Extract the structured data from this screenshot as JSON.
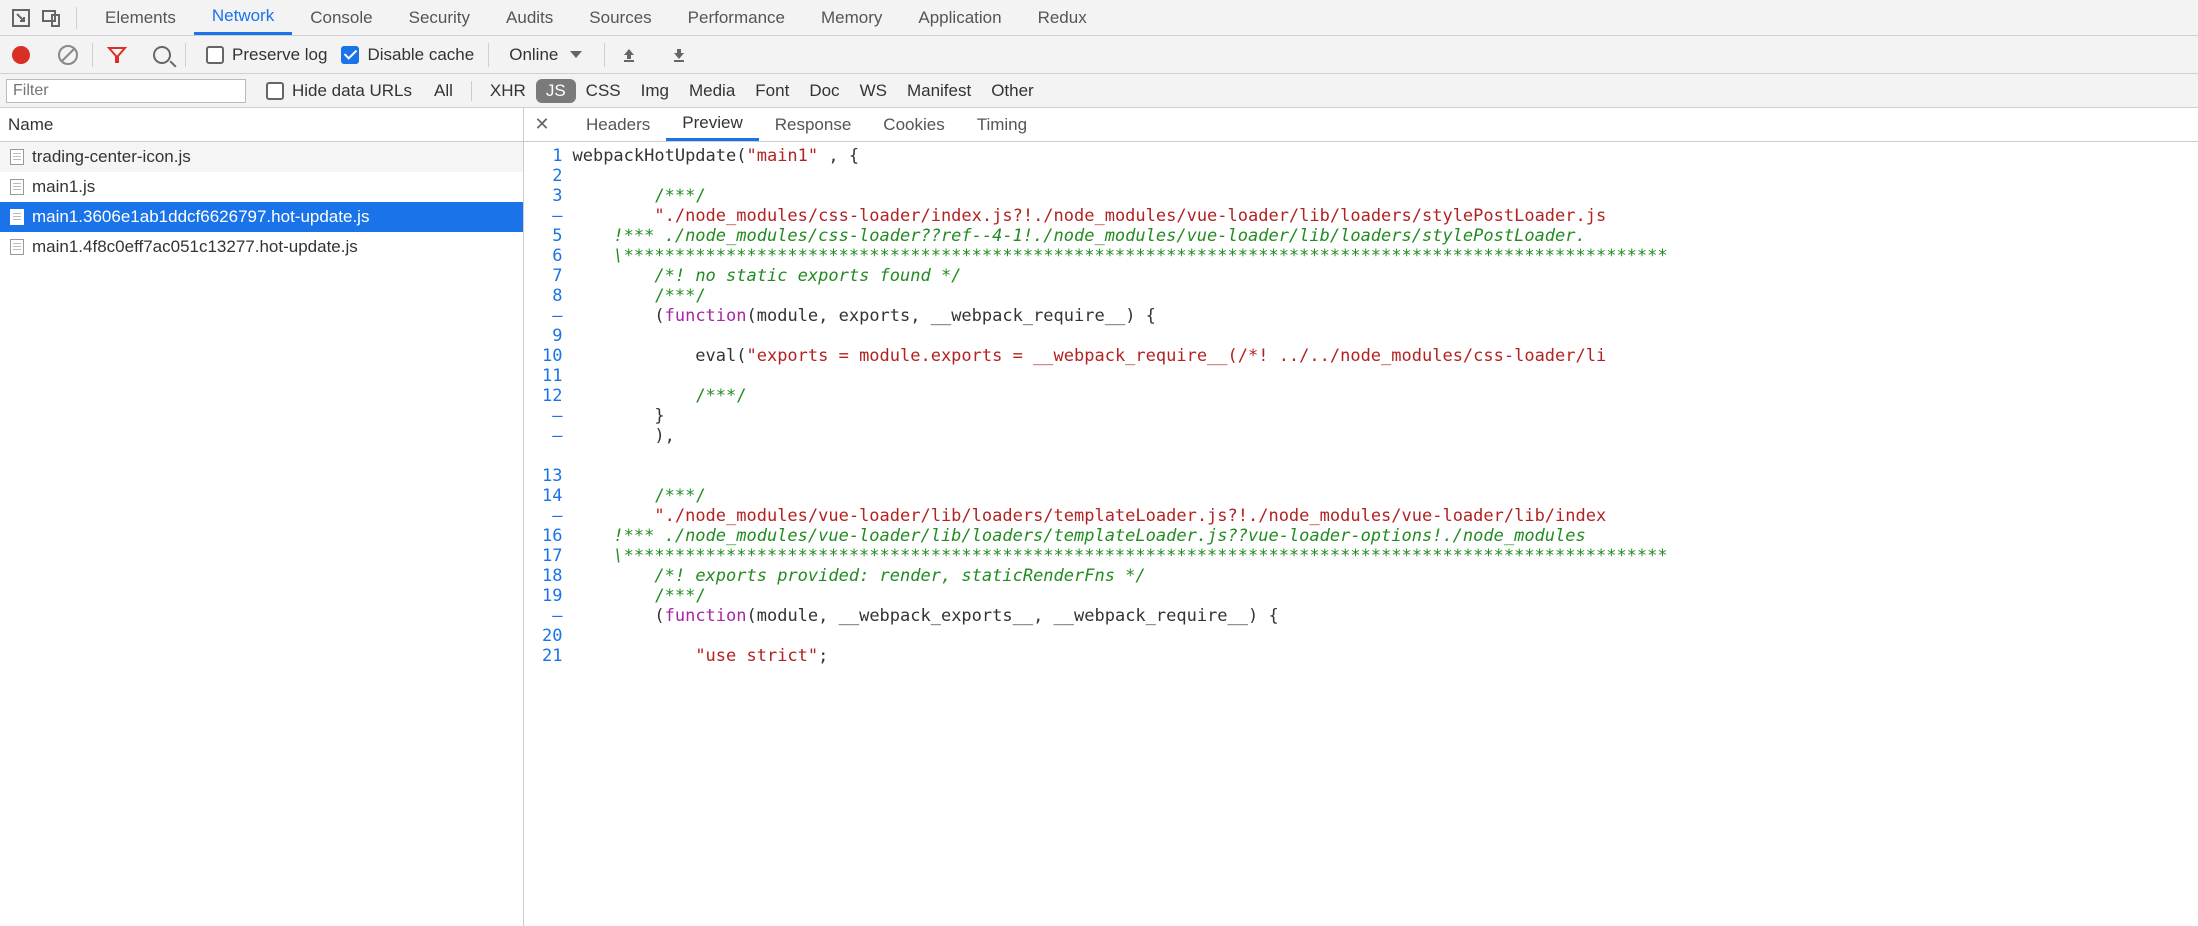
{
  "top_tabs": {
    "items": [
      "Elements",
      "Network",
      "Console",
      "Security",
      "Audits",
      "Sources",
      "Performance",
      "Memory",
      "Application",
      "Redux"
    ],
    "active": "Network"
  },
  "net_toolbar": {
    "preserve_log_label": "Preserve log",
    "preserve_log_checked": false,
    "disable_cache_label": "Disable cache",
    "disable_cache_checked": true,
    "online_label": "Online"
  },
  "filter_bar": {
    "placeholder": "Filter",
    "value": "",
    "hide_data_urls_label": "Hide data URLs",
    "hide_data_urls_checked": false,
    "type_all": "All",
    "types": [
      "XHR",
      "JS",
      "CSS",
      "Img",
      "Media",
      "Font",
      "Doc",
      "WS",
      "Manifest",
      "Other"
    ],
    "type_selected": "JS"
  },
  "req_list": {
    "header": "Name",
    "items": [
      "trading-center-icon.js",
      "main1.js",
      "main1.3606e1ab1ddcf6626797.hot-update.js",
      "main1.4f8c0eff7ac051c13277.hot-update.js"
    ],
    "selected_index": 2
  },
  "detail_tabs": {
    "items": [
      "Headers",
      "Preview",
      "Response",
      "Cookies",
      "Timing"
    ],
    "active": "Preview"
  },
  "code": {
    "gutter": [
      "1",
      "2",
      "3",
      "–",
      "5",
      "6",
      "7",
      "8",
      "–",
      "9",
      "10",
      "11",
      "12",
      "–",
      "–",
      "",
      "13",
      "14",
      "–",
      "16",
      "17",
      "18",
      "19",
      "–",
      "20",
      "21"
    ],
    "lines": [
      [
        [
          "",
          "webpackHotUpdate("
        ],
        [
          "s",
          "\"main1\""
        ],
        [
          "",
          " , {"
        ]
      ],
      [
        [
          "",
          ""
        ]
      ],
      [
        [
          "",
          "        "
        ],
        [
          "c2",
          "/***/"
        ]
      ],
      [
        [
          "",
          "        "
        ],
        [
          "s",
          "\"./node_modules/css-loader/index.js?!./node_modules/vue-loader/lib/loaders/stylePostLoader.js"
        ]
      ],
      [
        [
          "c",
          "    !*** ./node_modules/css-loader??ref--4-1!./node_modules/vue-loader/lib/loaders/stylePostLoader."
        ]
      ],
      [
        [
          "c",
          "    \\******************************************************************************************************"
        ]
      ],
      [
        [
          "",
          "        "
        ],
        [
          "c",
          "/*! no static exports found */"
        ]
      ],
      [
        [
          "",
          "        "
        ],
        [
          "c2",
          "/***/"
        ]
      ],
      [
        [
          "",
          "        ("
        ],
        [
          "k",
          "function"
        ],
        [
          "",
          "(module, exports, __webpack_require__) {"
        ]
      ],
      [
        [
          "",
          ""
        ]
      ],
      [
        [
          "",
          "            eval("
        ],
        [
          "s",
          "\"exports = module.exports = __webpack_require__(/*! ../../node_modules/css-loader/li"
        ]
      ],
      [
        [
          "",
          ""
        ]
      ],
      [
        [
          "",
          "            "
        ],
        [
          "c2",
          "/***/"
        ]
      ],
      [
        [
          "",
          "        }"
        ]
      ],
      [
        [
          "",
          "        ),"
        ]
      ],
      [
        [
          "",
          ""
        ]
      ],
      [
        [
          "",
          ""
        ]
      ],
      [
        [
          "",
          "        "
        ],
        [
          "c2",
          "/***/"
        ]
      ],
      [
        [
          "",
          "        "
        ],
        [
          "s",
          "\"./node_modules/vue-loader/lib/loaders/templateLoader.js?!./node_modules/vue-loader/lib/index"
        ]
      ],
      [
        [
          "c",
          "    !*** ./node_modules/vue-loader/lib/loaders/templateLoader.js??vue-loader-options!./node_modules"
        ]
      ],
      [
        [
          "c",
          "    \\******************************************************************************************************"
        ]
      ],
      [
        [
          "",
          "        "
        ],
        [
          "c",
          "/*! exports provided: render, staticRenderFns */"
        ]
      ],
      [
        [
          "",
          "        "
        ],
        [
          "c2",
          "/***/"
        ]
      ],
      [
        [
          "",
          "        ("
        ],
        [
          "k",
          "function"
        ],
        [
          "",
          "(module, __webpack_exports__, __webpack_require__) {"
        ]
      ],
      [
        [
          "",
          ""
        ]
      ],
      [
        [
          "",
          "            "
        ],
        [
          "s",
          "\"use strict\""
        ],
        [
          "",
          ";"
        ]
      ]
    ]
  }
}
